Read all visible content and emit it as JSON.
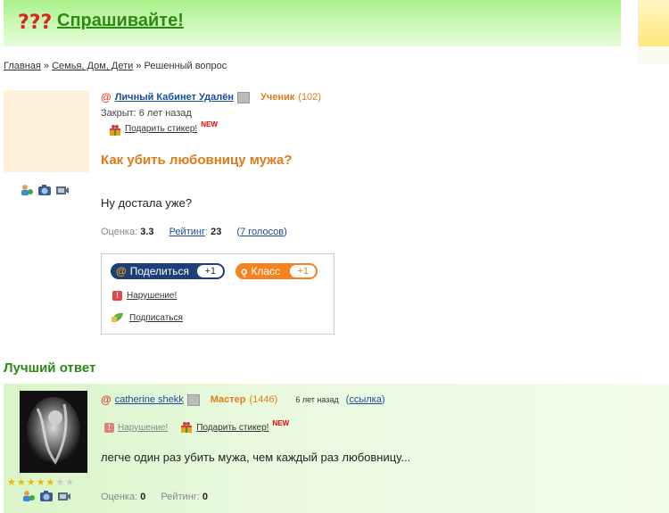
{
  "header": {
    "site_name": "Спрашивайте!"
  },
  "breadcrumb": {
    "home": "Главная",
    "sep": " » ",
    "category": "Семья, Дом, Дети",
    "current": "Решенный вопрос"
  },
  "question": {
    "user": {
      "name": "Личный Кабинет Удалён",
      "rank": "Ученик",
      "points": "(102)"
    },
    "closed": "Закрыт: 6 лет назад",
    "gift_sticker": "Подарить стикер!",
    "new_badge": "NEW",
    "title": "Как убить любовницу мужа?",
    "text": "Ну достала уже?",
    "stats": {
      "rating_label": "Оценка:",
      "rating_value": "3.3",
      "score_label": "Рейтинг",
      "score_value": "23",
      "votes": "7 голосов"
    }
  },
  "share": {
    "share_label": "Поделиться",
    "share_count": "+1",
    "class_label": "Класс",
    "class_count": "+1",
    "violation": "Нарушение!",
    "subscribe": "Подписаться"
  },
  "best_answer": {
    "heading": "Лучший ответ",
    "user": {
      "name": "catherine shekk",
      "rank": "Мастер",
      "points": "(1446)"
    },
    "time": "6 лет назад",
    "link_label": "ссылка",
    "violation": "Нарушение!",
    "gift_sticker": "Подарить стикер!",
    "new_badge": "NEW",
    "text": "легче один раз убить мужа, чем каждый раз любовницу...",
    "stats": {
      "rating_label": "Оценка:",
      "rating_value": "0",
      "score_label": "Рейтинг:",
      "score_value": "0"
    },
    "stars": {
      "filled": 5,
      "total": 7
    }
  },
  "colors": {
    "accent_green": "#2a8a14",
    "title_orange": "#e07a1a",
    "link_blue": "#1a4a9c",
    "share_navy": "#1d3f78",
    "ok_orange": "#f5821f"
  }
}
